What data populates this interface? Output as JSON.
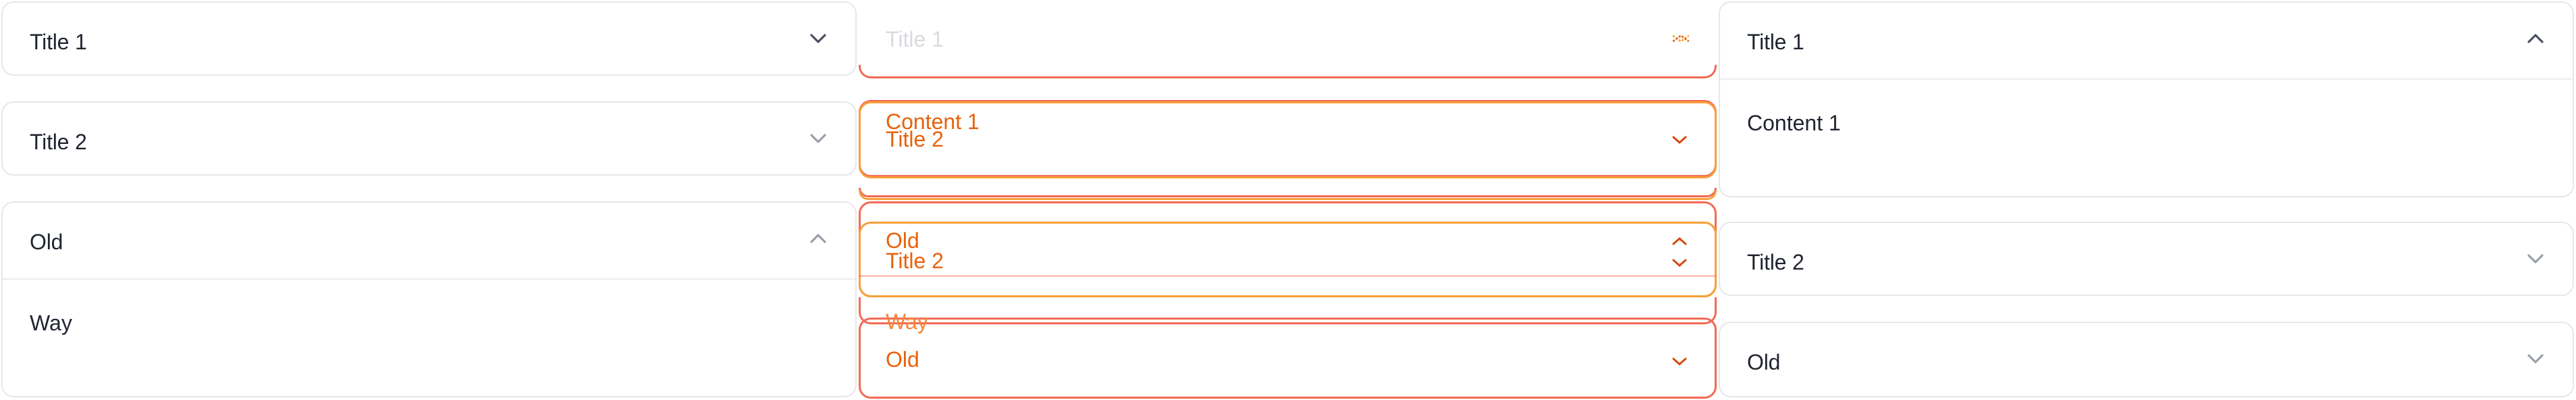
{
  "left_group": {
    "items": [
      {
        "title": "Title 1",
        "expanded": false
      },
      {
        "title": "Title 2",
        "expanded": false
      },
      {
        "title": "Old",
        "expanded": true,
        "content": "Way"
      }
    ]
  },
  "transition_group": {
    "ghost_labels": {
      "title1": "Title 1",
      "content1": "Content 1",
      "title2_a": "Title 2",
      "old_a": "Old",
      "title2_b": "Title 2",
      "way": "Way",
      "old_b": "Old"
    }
  },
  "right_group": {
    "items": [
      {
        "title": "Title 1",
        "expanded": true,
        "content": "Content 1"
      },
      {
        "title": "Title 2",
        "expanded": false
      },
      {
        "title": "Old",
        "expanded": false
      }
    ]
  },
  "colors": {
    "border": "#e6e7eb",
    "text": "#1f2430",
    "chevron": "#4b5060",
    "ghost_red": "#f26a55",
    "ghost_orange": "#e8620b"
  }
}
